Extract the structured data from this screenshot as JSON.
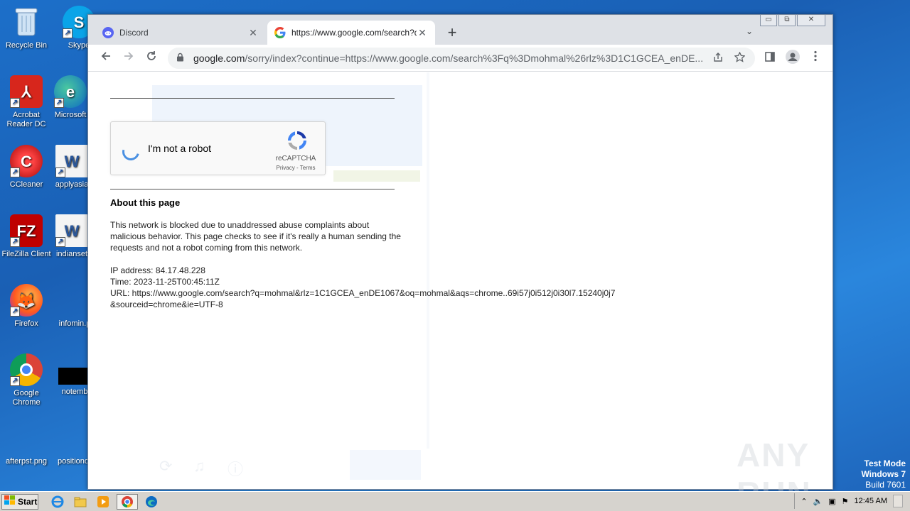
{
  "desktop": {
    "icons": [
      {
        "label": "Recycle Bin"
      },
      {
        "label": "Skype"
      },
      {
        "label": "Acrobat Reader DC"
      },
      {
        "label": "Microsoft"
      },
      {
        "label": "CCleaner"
      },
      {
        "label": "applyasia"
      },
      {
        "label": "FileZilla Client"
      },
      {
        "label": "indianset"
      },
      {
        "label": "Firefox"
      },
      {
        "label": "infomin.p"
      },
      {
        "label": "Google Chrome"
      },
      {
        "label": "notemb"
      },
      {
        "label": "afterpst.png"
      },
      {
        "label": "positiond"
      }
    ]
  },
  "browser": {
    "tabs": [
      {
        "title": "Discord",
        "close": "✕"
      },
      {
        "title": "https://www.google.com/search?q=",
        "close": "✕"
      }
    ],
    "new_tab": "+",
    "tab_search": "⌄",
    "window_controls": {
      "minimize": "▭",
      "maximize": "⧉",
      "close": "✕"
    },
    "omnibox": {
      "host": "google.com",
      "rest": "/sorry/index?continue=https://www.google.com/search%3Fq%3Dmohmal%26rlz%3D1C1GCEA_enDE..."
    }
  },
  "page": {
    "recaptcha": {
      "label": "I'm not a robot",
      "brand": "reCAPTCHA",
      "links": "Privacy - Terms"
    },
    "about_title": "About this page",
    "blocked_text": "This network is blocked due to unaddressed abuse complaints about malicious behavior. This page checks to see if it's really a human sending the requests and not a robot coming from this network.",
    "ip_line": "IP address: 84.17.48.228",
    "time_line": "Time: 2023-11-25T00:45:11Z",
    "url_line": "URL: https://www.google.com/search?q=mohmal&rlz=1C1GCEA_enDE1067&oq=mohmal&aqs=chrome..69i57j0i512j0i30l7.15240j0j7&sourceid=chrome&ie=UTF-8"
  },
  "watermark": {
    "text": "ANY RUN"
  },
  "os_info": {
    "line1": "Test Mode",
    "line2": "Windows 7",
    "line3": "Build 7601"
  },
  "taskbar": {
    "start_label": "Start",
    "clock": "12:45 AM"
  },
  "colors": {
    "accent": "#1a73e8",
    "discord": "#5865f2",
    "tabstrip": "#dee1e6"
  }
}
